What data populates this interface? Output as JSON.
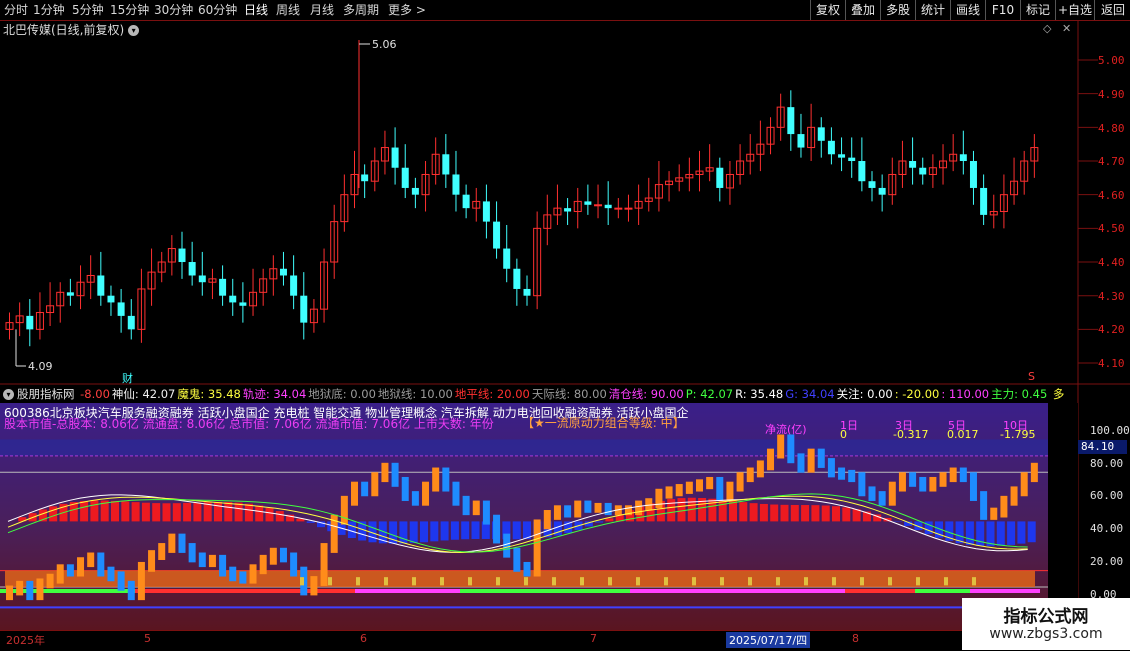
{
  "toolbar": {
    "periods": [
      "分时",
      "1分钟",
      "5分钟",
      "15分钟",
      "30分钟",
      "60分钟",
      "日线",
      "周线",
      "月线",
      "多周期",
      "更多 >"
    ],
    "active_period": "日线",
    "right_buttons": [
      "复权",
      "叠加",
      "多股",
      "统计",
      "画线",
      "F10",
      "标记",
      "+自选",
      "返回"
    ]
  },
  "chart_title": "北巴传媒(日线,前复权)",
  "price_axis": [
    "5.00",
    "4.90",
    "4.80",
    "4.70",
    "4.60",
    "4.50",
    "4.40",
    "4.30",
    "4.20",
    "4.10"
  ],
  "annotations": {
    "high": "5.06",
    "low": "4.09",
    "cai": "财",
    "s_mark": "S"
  },
  "indicator": {
    "name": "股朋指标网",
    "values": [
      {
        "label": "",
        "value": "-8.00",
        "color": "#ff4040"
      },
      {
        "label": "神仙:",
        "value": "42.07",
        "color": "#f0f0f0"
      },
      {
        "label": "魔鬼:",
        "value": "35.48",
        "color": "#ffff40"
      },
      {
        "label": "轨迹:",
        "value": "34.04",
        "color": "#ff40ff"
      },
      {
        "label": "地狱底:",
        "value": "0.00",
        "color": "#9a9a9a"
      },
      {
        "label": "地狱线:",
        "value": "10.00",
        "color": "#9a9a9a"
      },
      {
        "label": "地平线:",
        "value": "20.00",
        "color": "#ff3030"
      },
      {
        "label": "天际线:",
        "value": "80.00",
        "color": "#9a9a9a"
      },
      {
        "label": "清仓线:",
        "value": "90.00",
        "color": "#ff40ff"
      },
      {
        "label": "P:",
        "value": "42.07",
        "color": "#40ff40"
      },
      {
        "label": "R:",
        "value": "35.48",
        "color": "#ffffff"
      },
      {
        "label": "G:",
        "value": "34.04",
        "color": "#4040ff"
      },
      {
        "label": "关注:",
        "value": "0.00",
        "color": "#ffffff"
      },
      {
        "label": ":",
        "value": "-20.00",
        "color": "#ffff40"
      },
      {
        "label": ":",
        "value": "110.00",
        "color": "#ff40ff"
      },
      {
        "label": "主力:",
        "value": "0.45",
        "color": "#40ff40"
      },
      {
        "label": "",
        "value": "多",
        "color": "#ffff40"
      }
    ]
  },
  "info": {
    "line1": "600386北京板块汽车服务融资融券 活跃小盘国企 充电桩 智能交通 物业管理概念 汽车拆解 动力电池回收融资融券 活跃小盘国企",
    "line2": "股本市值-总股本: 8.06亿 流通盘: 8.06亿 总市值: 7.06亿 流通市值: 7.06亿 上市天数: 年份",
    "line3": "【★一流原动力组合等级: 中】",
    "net_title": "净流(亿)",
    "periods": [
      "1日",
      "3日",
      "5日",
      "10日"
    ],
    "net_values": [
      "0",
      "-0.317",
      "0.017",
      "-1.795"
    ]
  },
  "sub_axis": [
    "100.00",
    "80.00",
    "60.00",
    "40.00",
    "20.00",
    "0.00"
  ],
  "sub_current": "84.10",
  "dates": [
    "2025年",
    "5",
    "6",
    "7",
    "2025/07/17/四",
    "8"
  ],
  "logo": {
    "line1": "指标公式网",
    "line2": "www.zbgs3.com"
  },
  "colors": {
    "up": "#ff3030",
    "down": "#40ffff",
    "bar_orange": "#ff8c1a",
    "bar_blue": "#1e8cff"
  }
}
